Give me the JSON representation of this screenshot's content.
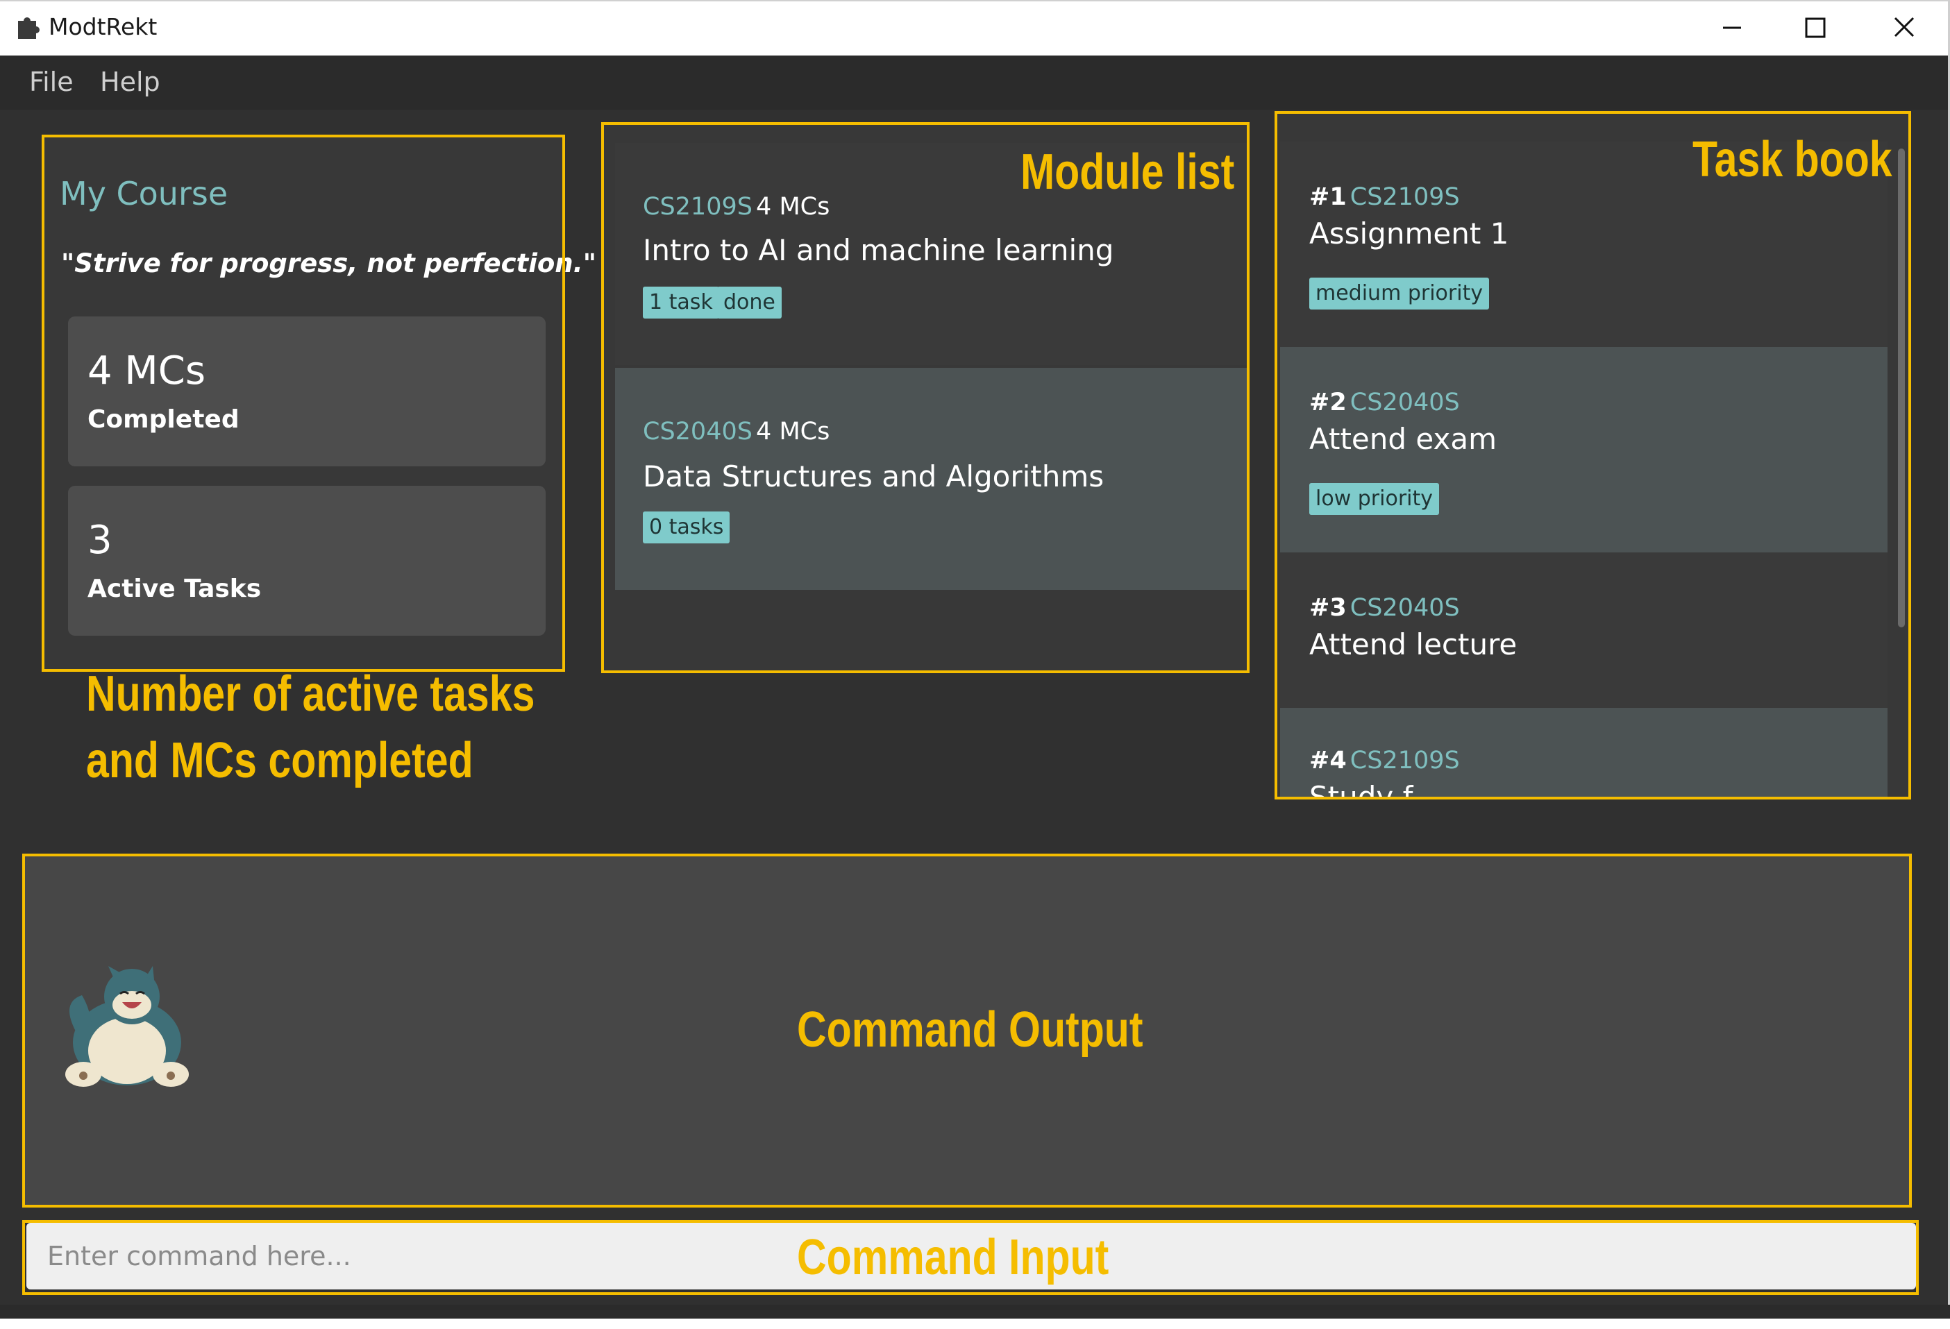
{
  "window": {
    "title": "ModtRekt",
    "icon": "puzzle-piece-icon"
  },
  "menu": {
    "items": [
      "File",
      "Help"
    ]
  },
  "course": {
    "title": "My Course",
    "quote": "\"Strive for progress, not perfection.\"",
    "stats": [
      {
        "value": "4 MCs",
        "label": "Completed"
      },
      {
        "value": "3",
        "label": "Active Tasks"
      }
    ]
  },
  "modules": [
    {
      "code": "CS2109S",
      "mcs": "4 MCs",
      "name": "Intro to AI and machine learning",
      "tags": [
        "1 task",
        "done"
      ]
    },
    {
      "code": "CS2040S",
      "mcs": "4 MCs",
      "name": "Data Structures and Algorithms",
      "tags": [
        "0 tasks"
      ]
    }
  ],
  "tasks": [
    {
      "num": "#1",
      "code": "CS2109S",
      "name": "Assignment 1",
      "tag": "medium priority"
    },
    {
      "num": "#2",
      "code": "CS2040S",
      "name": "Attend exam",
      "tag": "low priority"
    },
    {
      "num": "#3",
      "code": "CS2040S",
      "name": "Attend lecture",
      "tag": ""
    },
    {
      "num": "#4",
      "code": "CS2109S",
      "name": "Study f",
      "tag": ""
    }
  ],
  "command": {
    "placeholder": "Enter command here..."
  },
  "annotations": {
    "stats_line1": "Number of active tasks",
    "stats_line2": "and MCs completed",
    "module_list": "Module list",
    "task_book": "Task book",
    "command_output": "Command Output",
    "command_input": "Command Input"
  },
  "colors": {
    "accent": "#7fbfbf",
    "tag": "#7fcbcb",
    "annotation": "#f5bd00",
    "background": "#303030"
  }
}
